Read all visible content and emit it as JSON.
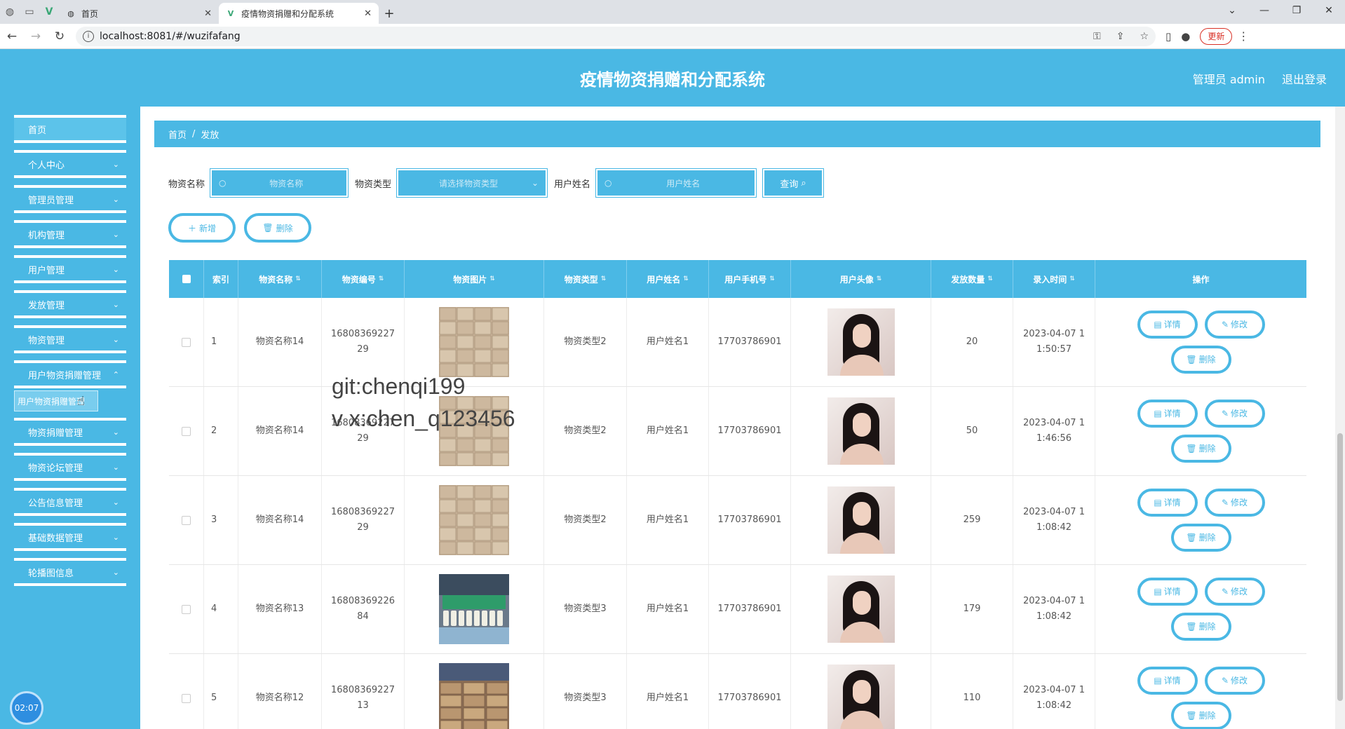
{
  "browser": {
    "tabs": [
      {
        "title": "首页",
        "active": false
      },
      {
        "title": "疫情物资捐赠和分配系统",
        "active": true
      }
    ],
    "url": "localhost:8081/#/wuzifafang",
    "update_label": "更新"
  },
  "header": {
    "title": "疫情物资捐赠和分配系统",
    "role_user": "管理员 admin",
    "logout": "退出登录"
  },
  "sidebar": {
    "items": [
      {
        "label": "首页"
      },
      {
        "label": "个人中心"
      },
      {
        "label": "管理员管理"
      },
      {
        "label": "机构管理"
      },
      {
        "label": "用户管理"
      },
      {
        "label": "发放管理"
      },
      {
        "label": "物资管理"
      },
      {
        "label": "用户物资捐赠管理"
      },
      {
        "label": "物资捐赠管理"
      },
      {
        "label": "物资论坛管理"
      },
      {
        "label": "公告信息管理"
      },
      {
        "label": "基础数据管理"
      },
      {
        "label": "轮播图信息"
      }
    ],
    "submenu_label": "用户物资捐赠管理",
    "clock": "02:07"
  },
  "breadcrumb": {
    "home": "首页",
    "sep": "/",
    "current": "发放"
  },
  "search": {
    "name_label": "物资名称",
    "name_placeholder": "物资名称",
    "type_label": "物资类型",
    "type_placeholder": "请选择物资类型",
    "user_label": "用户姓名",
    "user_placeholder": "用户姓名",
    "query_button": "查询"
  },
  "actions": {
    "add": "新增",
    "delete": "删除"
  },
  "table": {
    "headers": [
      "索引",
      "物资名称",
      "物资编号",
      "物资图片",
      "物资类型",
      "用户姓名",
      "用户手机号",
      "用户头像",
      "发放数量",
      "录入时间",
      "操作"
    ],
    "rows": [
      {
        "idx": "1",
        "name": "物资名称14",
        "code1": "16808369227",
        "code2": "29",
        "type": "物资类型2",
        "user": "用户姓名1",
        "phone": "17703786901",
        "qty": "20",
        "time1": "2023-04-07 1",
        "time2": "1:50:57",
        "img": "boxes"
      },
      {
        "idx": "2",
        "name": "物资名称14",
        "code1": "16808369227",
        "code2": "29",
        "type": "物资类型2",
        "user": "用户姓名1",
        "phone": "17703786901",
        "qty": "50",
        "time1": "2023-04-07 1",
        "time2": "1:46:56",
        "img": "boxes"
      },
      {
        "idx": "3",
        "name": "物资名称14",
        "code1": "16808369227",
        "code2": "29",
        "type": "物资类型2",
        "user": "用户姓名1",
        "phone": "17703786901",
        "qty": "259",
        "time1": "2023-04-07 1",
        "time2": "1:08:42",
        "img": "boxes"
      },
      {
        "idx": "4",
        "name": "物资名称13",
        "code1": "16808369226",
        "code2": "84",
        "type": "物资类型3",
        "user": "用户姓名1",
        "phone": "17703786901",
        "qty": "179",
        "time1": "2023-04-07 1",
        "time2": "1:08:42",
        "img": "bottles"
      },
      {
        "idx": "5",
        "name": "物资名称12",
        "code1": "16808369227",
        "code2": "13",
        "type": "物资类型3",
        "user": "用户姓名1",
        "phone": "17703786901",
        "qty": "110",
        "time1": "2023-04-07 1",
        "time2": "1:08:42",
        "img": "warehouse"
      }
    ],
    "op_detail": "详情",
    "op_edit": "修改",
    "op_delete": "删除"
  },
  "watermark": {
    "line1": "git:chenqi199",
    "line2": "v x:chen_q123456"
  },
  "colors": {
    "primary": "#4ab8e4"
  }
}
